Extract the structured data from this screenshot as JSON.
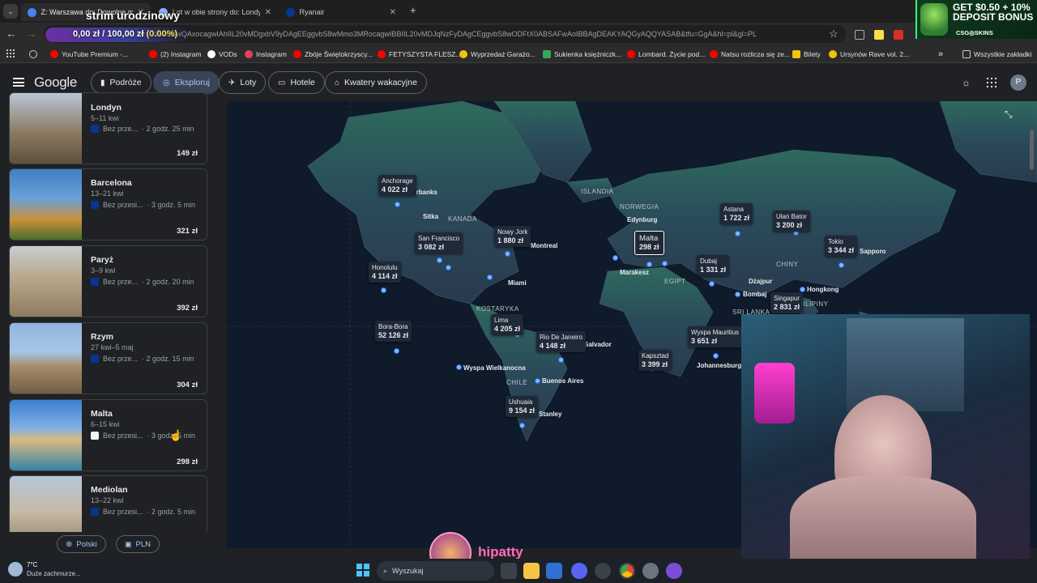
{
  "tabs": [
    {
      "label": "Z: Warszawa do: Dowolne miejsce"
    },
    {
      "label": "Lot w obie strony do: Londyn | Google"
    },
    {
      "label": "Ryanair"
    }
  ],
  "omnibox": {
    "url": "google.com/travel/explore?tfs=CBwQAxocagwIAhIIL20vMDgxbV9yDAgEEggvbS8wMmo3MRocagwIBBIIL20vMDJqNzFyDAgCEggvbS8wODFtX0ABSAFwAoIBBAgDEAKYAQGyAQQYASAB&tfu=GgA&hl=pl&gl=PL"
  },
  "stream_overlay": {
    "title": "strim urodzinowy",
    "progress": "0,00 zł / 100,00 zł",
    "progress_pct": "(0.00%)",
    "progress_fraction": 0
  },
  "ad": {
    "line1": "GET $0.50 + 10%",
    "line2": "DEPOSIT BONUS",
    "brand": "CSG◎SKINS"
  },
  "bookmarks": [
    "YouTube Premium -...",
    "(2) Instagram",
    "VODs",
    "Instagram",
    "Zbóje Świętokrzyscy...",
    "FETYSZYSTA FLESZ...",
    "Wyprzedaż Garażo...",
    "Sukienka księżniczk...",
    "Lombard. Życie pod...",
    "Natsu rozlicza się ze...",
    "Bilety",
    "Ursynów Rave vol. 2...",
    "Wszystkie zakładki"
  ],
  "google": {
    "logo": "Google",
    "nav": [
      "Podróże",
      "Eksploruj",
      "Loty",
      "Hotele",
      "Kwatery wakacyjne"
    ],
    "avatar": "P"
  },
  "destinations": [
    {
      "name": "Londyn",
      "dates": "5–11 kwi",
      "stops": "Bez prze...",
      "duration": "· 2 godz. 25 min",
      "price": "149 zł"
    },
    {
      "name": "Barcelona",
      "dates": "13–21 kwi",
      "stops": "Bez przesi...",
      "duration": "· 3 godz. 5 min",
      "price": "321 zł"
    },
    {
      "name": "Paryż",
      "dates": "3–9 kwi",
      "stops": "Bez prze...",
      "duration": "· 2 godz. 20 min",
      "price": "392 zł"
    },
    {
      "name": "Rzym",
      "dates": "27 kwi–5 maj",
      "stops": "Bez prze...",
      "duration": "· 2 godz. 15 min",
      "price": "304 zł"
    },
    {
      "name": "Malta",
      "dates": "6–15 kwi",
      "stops": "Bez przesi...",
      "duration": "· 3 godz. 5 min",
      "price": "298 zł"
    },
    {
      "name": "Mediolan",
      "dates": "13–22 kwi",
      "stops": "Bez przesi...",
      "duration": "· 2 godz. 5 min",
      "price": ""
    }
  ],
  "footer": {
    "language": "Polski",
    "currency": "PLN"
  },
  "map": {
    "price_labels": [
      {
        "city": "Anchorage",
        "price": "4 022 zł"
      },
      {
        "city": "San Francisco",
        "price": "3 082 zł"
      },
      {
        "city": "Nowy Jork",
        "price": "1 880 zł"
      },
      {
        "city": "Honolulu",
        "price": "4 114 zł"
      },
      {
        "city": "Bora-Bora",
        "price": "52 126 zł"
      },
      {
        "city": "Lima",
        "price": "4 205 zł"
      },
      {
        "city": "Rio De Janeiro",
        "price": "4 148 zł"
      },
      {
        "city": "Ushuaia",
        "price": "9 154 zł"
      },
      {
        "city": "Malta",
        "price": "298 zł"
      },
      {
        "city": "Astana",
        "price": "1 722 zł"
      },
      {
        "city": "Ulan Bator",
        "price": "3 200 zł"
      },
      {
        "city": "Tokio",
        "price": "3 344 zł"
      },
      {
        "city": "Dubaj",
        "price": "1 331 zł"
      },
      {
        "city": "Singapur",
        "price": "2 831 zł"
      },
      {
        "city": "Wyspa Mauritius",
        "price": "3 651 zł"
      },
      {
        "city": "Kapsztad",
        "price": "3 399 zł"
      }
    ],
    "country_labels": [
      "ISLANDIA",
      "KANADA",
      "NORWEGIA",
      "CHINY",
      "EGIPT",
      "KOSTARYKA",
      "CHILE",
      "SRI LANKA",
      "FILIPINY"
    ],
    "city_labels": [
      "Edynburg",
      "Sitka",
      "Miami",
      "Marakesz",
      "Dżajpur",
      "Bombaj",
      "Hongkong",
      "Wyspa Wielkanocna",
      "Buenos Aires",
      "Johannesburg",
      "Fairbanks",
      "Montreal",
      "Salvador",
      "Stanley",
      "Sapporo"
    ]
  },
  "streamer": {
    "name": "hipatty"
  },
  "weather": {
    "temp": "7°C",
    "desc": "Duże zachmurze..."
  },
  "taskbar": {
    "search": "Wyszukaj"
  }
}
